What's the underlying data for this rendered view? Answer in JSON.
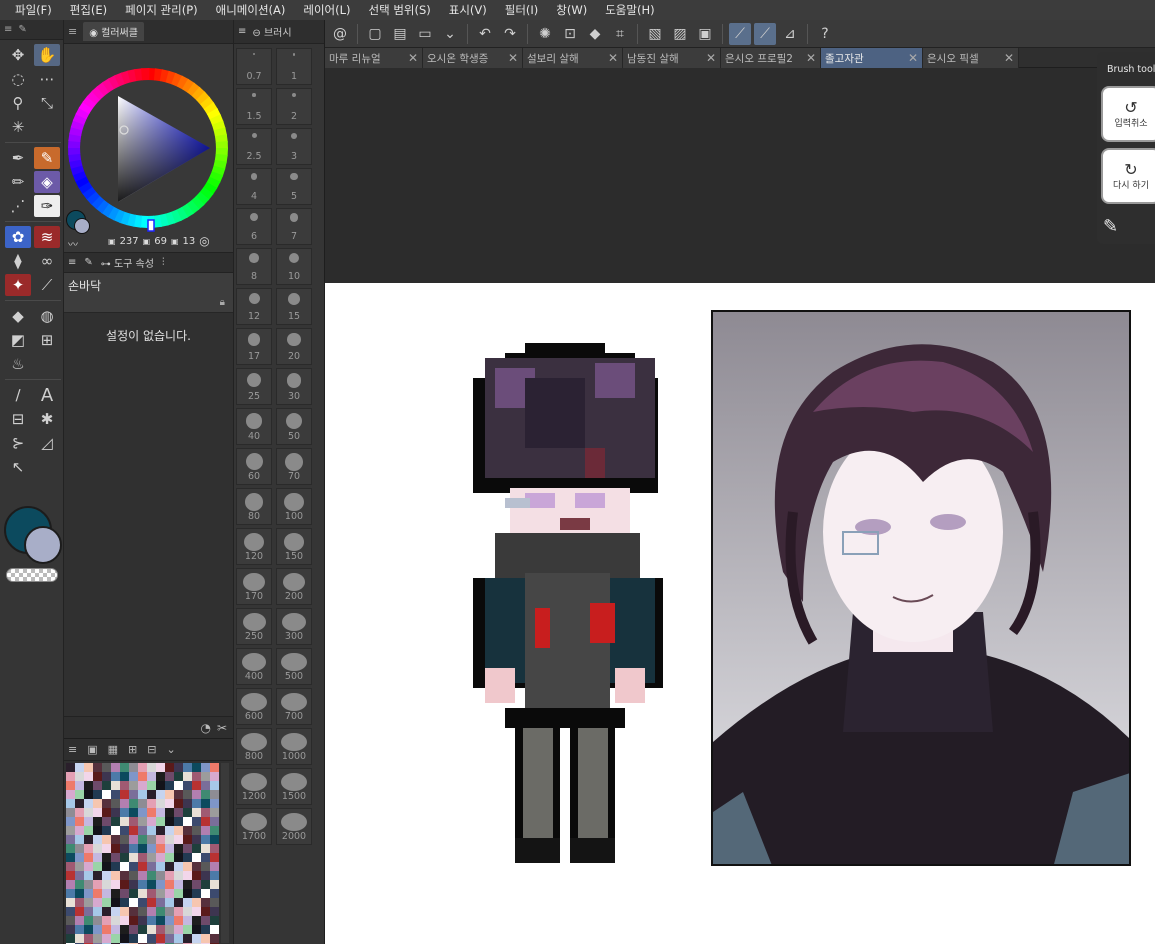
{
  "menu": [
    "파일(F)",
    "편집(E)",
    "페이지 관리(P)",
    "애니메이션(A)",
    "레이어(L)",
    "선택 범위(S)",
    "표시(V)",
    "필터(I)",
    "창(W)",
    "도움말(H)"
  ],
  "color_wheel": {
    "tab_label": "컬러써클",
    "h_value": "237",
    "s_value": "69",
    "v_value": "13"
  },
  "tool_property": {
    "tab_label": "도구 속성",
    "subtool_name": "손바닥",
    "empty_message": "설정이 없습니다."
  },
  "brush_size": {
    "tab_label": "브러시",
    "sizes": [
      "0.7",
      "1",
      "1.5",
      "2",
      "2.5",
      "3",
      "4",
      "5",
      "6",
      "7",
      "8",
      "10",
      "12",
      "15",
      "17",
      "20",
      "25",
      "30",
      "40",
      "50",
      "60",
      "70",
      "80",
      "100",
      "120",
      "150",
      "170",
      "200",
      "250",
      "300",
      "400",
      "500",
      "600",
      "700",
      "800",
      "1000",
      "1200",
      "1500",
      "1700",
      "2000"
    ]
  },
  "document_tabs": [
    {
      "label": "마루 리뉴얼",
      "active": false
    },
    {
      "label": "오시온 학생증",
      "active": false
    },
    {
      "label": "설보리 살해",
      "active": false
    },
    {
      "label": "남동진 살해",
      "active": false
    },
    {
      "label": "은시오 프로필2",
      "active": false
    },
    {
      "label": "졸고자관",
      "active": true
    },
    {
      "label": "은시오 픽셀",
      "active": false
    }
  ],
  "edge_toolbar": {
    "title": "Brush tool",
    "undo_label": "입력취소",
    "redo_label": "다시 하기"
  },
  "colors": {
    "main_color": "#0c4a5e",
    "sub_color": "#a8aec8",
    "accent": "#566884"
  },
  "icons": [
    "hand-icon",
    "zoom-icon",
    "lasso-icon",
    "eyedropper-icon",
    "pen-icon",
    "pencil-icon",
    "brush-icon",
    "eraser-icon",
    "fill-icon",
    "gradient-icon",
    "text-icon",
    "undo-icon",
    "redo-icon",
    "lock-icon",
    "close-icon"
  ]
}
